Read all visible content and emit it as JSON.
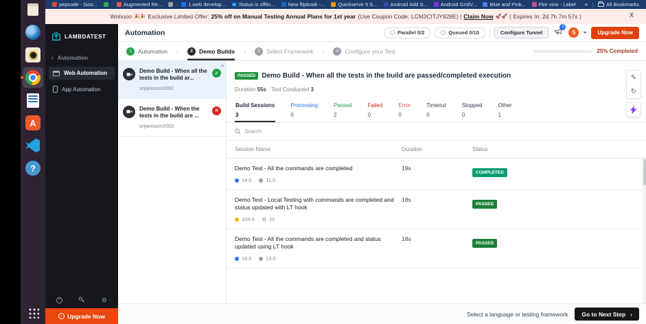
{
  "browser": {
    "bookmarks": [
      {
        "label": "pepcode - Goo...",
        "color": "#e8453c"
      },
      {
        "label": "",
        "color": "#34a853"
      },
      {
        "label": "Augmented Re...",
        "color": "#e2574c"
      },
      {
        "label": "",
        "color": "#9aa0a6"
      },
      {
        "label": "1.web develop...",
        "color": "#1a73e8"
      },
      {
        "label": "Status is offlin...",
        "color": "#0a66c2",
        "glyph": "in"
      },
      {
        "label": "New flipbook -...",
        "color": "#1565c0"
      },
      {
        "label": "Quickserve It S...",
        "color": "#f29900"
      },
      {
        "label": "Android Add S...",
        "color": "#3949ab"
      },
      {
        "label": "Android GridV...",
        "color": "#7b2ff7"
      },
      {
        "label": "Blue and Pink...",
        "color": "#4f7df9"
      },
      {
        "label": "Flor vino - Label",
        "color": "#c94f7c"
      }
    ],
    "overflow": "»",
    "all_bookmarks": "All Bookmarks"
  },
  "banner": {
    "intro": "Wohooo",
    "emoji": "🎉🎉",
    "offer_label": "Exclusive Limited Offer:",
    "offer_bold": "25% off on Manual Testing Annual Plans for 1st year",
    "coupon": "(Use Coupon Code: LCM3CITJY828E) |",
    "claim": "Claim Now",
    "rockets": "🚀🚀",
    "expires": "( Expires In: 2d 7h 7m 57s )",
    "close": "X"
  },
  "sidebar": {
    "logo_text": "LAMBDATEST",
    "back_chevron": "‹",
    "section": "Automation",
    "items": [
      {
        "label": "Web Automation"
      },
      {
        "label": "App Automation"
      }
    ],
    "upgrade_label": "Upgrade Now"
  },
  "header": {
    "title": "Automation",
    "parallel_label": "Parallel 0/2",
    "queued_label": "Queued 0/10",
    "tunnel_label": "Configure Tunnel",
    "notification_count": "3",
    "avatar_initial": "S",
    "upgrade_label": "Upgrade Now"
  },
  "stepper": {
    "steps": [
      {
        "num": "1",
        "label": "Automation"
      },
      {
        "num": "2",
        "label": "Demo Builds"
      },
      {
        "num": "3",
        "label": "Select Framework"
      },
      {
        "num": "4",
        "label": "Configure your Test"
      }
    ],
    "chevron": "›",
    "progress_pct": 25,
    "progress_label": "25% Completed"
  },
  "builds": {
    "items": [
      {
        "title": "Demo Build - When all the tests in the build ar...",
        "user": "srijanisom2002",
        "status_glyph": "✓",
        "status_color": "#23a24b"
      },
      {
        "title": "Demo Build - When the tests in the build are ...",
        "user": "srijanisom2002",
        "status_glyph": "✕",
        "status_color": "#e02424"
      }
    ]
  },
  "detail": {
    "status_badge": "PASSED",
    "status_color": "#21923d",
    "title": "Demo Build - When all the tests in the build are passed/completed execution",
    "duration_label": "Duration",
    "duration_value": "55s",
    "dot_sep": "·",
    "tests_label": "Test Conducted",
    "tests_value": "3",
    "tabs": [
      {
        "label": "Build Sessions",
        "count": "3",
        "color": "#1f2937"
      },
      {
        "label": "Processing",
        "count": "0",
        "color": "#2f6fed"
      },
      {
        "label": "Passed",
        "count": "2",
        "color": "#1e9e4f"
      },
      {
        "label": "Failed",
        "count": "0",
        "color": "#e02424"
      },
      {
        "label": "Error",
        "count": "0",
        "color": "#eb5a2d"
      },
      {
        "label": "Timeout",
        "count": "0",
        "color": "#374151"
      },
      {
        "label": "Stopped",
        "count": "0",
        "color": "#374151"
      },
      {
        "label": "Other",
        "count": "1",
        "color": "#374151"
      }
    ],
    "search_placeholder": "Search",
    "table": {
      "headers": [
        "Session Name",
        "Duration",
        "Status"
      ],
      "rows": [
        {
          "name": "Demo Test - All the commands are completed",
          "browser_version": "14.0",
          "browser_color": "#2f6fed",
          "os": "macos",
          "os_version": "11.0",
          "duration": "19s",
          "status": "COMPLETED",
          "status_color": "#0e9d72"
        },
        {
          "name": "Demo Test - Local Testing with commands are completed and status updated with LT hook",
          "browser_version": "104.0",
          "browser_color": "#f4b400",
          "os": "windows",
          "os_version": "10",
          "duration": "18s",
          "status": "PASSED",
          "status_color": "#1a7f37"
        },
        {
          "name": "Demo Test - All the commands are completed and status updated using LT hook",
          "browser_version": "16.0",
          "browser_color": "#2f6fed",
          "os": "macos",
          "os_version": "13.0",
          "duration": "18s",
          "status": "PASSED",
          "status_color": "#1a7f37"
        }
      ]
    }
  },
  "footer": {
    "hint": "Select a language or testing framework",
    "next_label": "Go to Next Step",
    "chevron": "›"
  }
}
